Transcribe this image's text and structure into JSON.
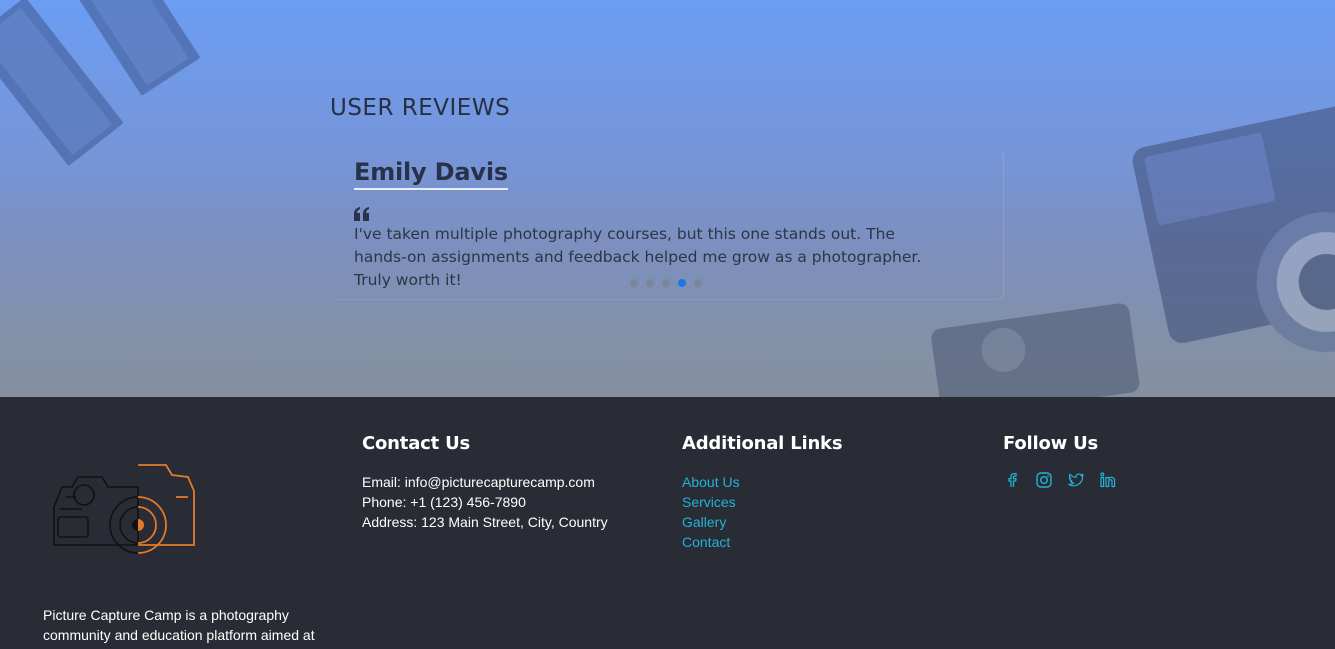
{
  "reviews": {
    "section_title": "USER REVIEWS",
    "current": {
      "name": "Emily Davis",
      "text": "I've taken multiple photography courses, but this one stands out. The hands-on assignments and feedback helped me grow as a photographer. Truly worth it!"
    },
    "dot_count": 5,
    "active_dot": 3,
    "accent_color": "#1779e8"
  },
  "footer": {
    "logo_icon": "camera-logo-icon",
    "about": "Picture Capture Camp is a photography community and education platform aimed at",
    "contact": {
      "heading": "Contact Us",
      "email": "Email: info@picturecapturecamp.com",
      "phone": "Phone: +1 (123) 456-7890",
      "address": "Address: 123 Main Street, City, Country"
    },
    "links": {
      "heading": "Additional Links",
      "items": [
        "About Us",
        "Services",
        "Gallery",
        "Contact"
      ],
      "link_color": "#20b4d6"
    },
    "follow": {
      "heading": "Follow Us",
      "icons": [
        "facebook-icon",
        "instagram-icon",
        "twitter-icon",
        "linkedin-icon"
      ]
    }
  }
}
